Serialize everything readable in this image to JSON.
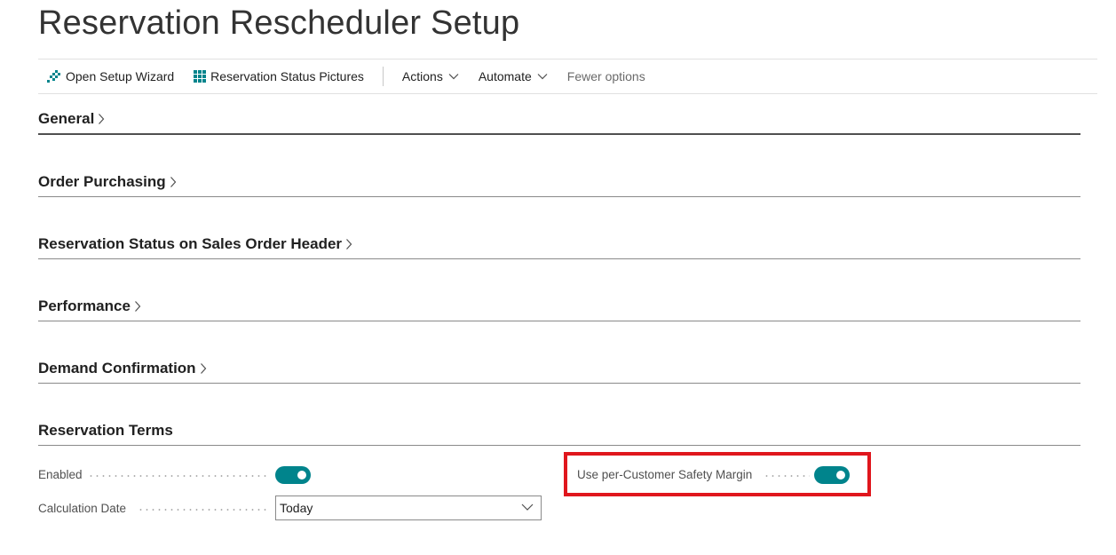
{
  "page": {
    "title": "Reservation Rescheduler Setup"
  },
  "actionbar": {
    "open_wizard": "Open Setup Wizard",
    "status_pictures": "Reservation Status Pictures",
    "actions": "Actions",
    "automate": "Automate",
    "fewer_options": "Fewer options"
  },
  "sections": {
    "general": "General",
    "order_purchasing": "Order Purchasing",
    "status_header": "Reservation Status on Sales Order Header",
    "performance": "Performance",
    "demand_confirmation": "Demand Confirmation",
    "reservation_terms": "Reservation Terms"
  },
  "fields": {
    "enabled": {
      "label": "Enabled",
      "value": true
    },
    "calculation_date": {
      "label": "Calculation Date",
      "value": "Today"
    },
    "safety_margin": {
      "label": "Use per-Customer Safety Margin",
      "value": true
    }
  },
  "colors": {
    "accent": "#00848c",
    "highlight": "#e0161d"
  }
}
